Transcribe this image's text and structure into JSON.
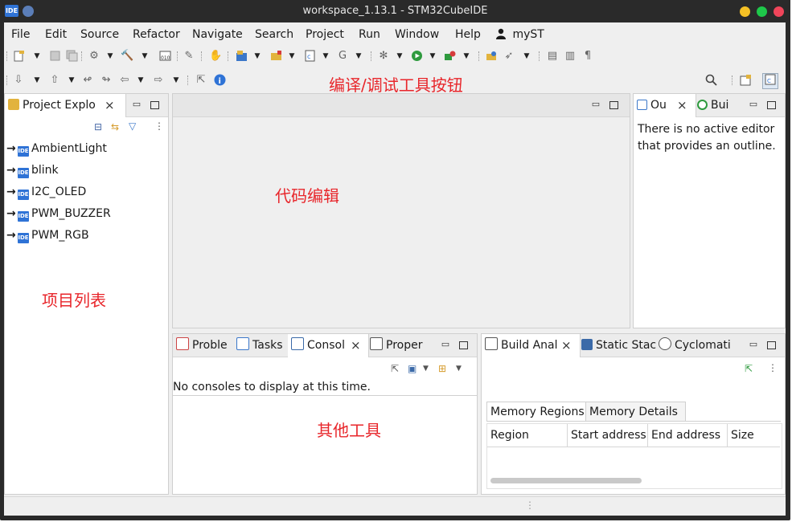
{
  "window": {
    "title": "workspace_1.13.1 - STM32CubeIDE",
    "app_icon_text": "IDE"
  },
  "colors": {
    "annotation": "#e8262b",
    "ide_blue": "#2f73d6",
    "frame": "#2a2a2a"
  },
  "menu": [
    {
      "label": "File"
    },
    {
      "label": "Edit"
    },
    {
      "label": "Source"
    },
    {
      "label": "Refactor"
    },
    {
      "label": "Navigate"
    },
    {
      "label": "Search"
    },
    {
      "label": "Project"
    },
    {
      "label": "Run"
    },
    {
      "label": "Window"
    },
    {
      "label": "Help"
    },
    {
      "label": "myST",
      "icon": "user-icon"
    }
  ],
  "annotations": {
    "toolbar": "编译/调试工具按钮",
    "editor": "代码编辑",
    "project_list": "项目列表",
    "other_tools": "其他工具"
  },
  "project_explorer": {
    "tab_label": "Project Explo",
    "projects": [
      {
        "name": "AmbientLight"
      },
      {
        "name": "blink"
      },
      {
        "name": "I2C_OLED"
      },
      {
        "name": "PWM_BUZZER"
      },
      {
        "name": "PWM_RGB"
      }
    ]
  },
  "outline": {
    "tabs": [
      "Ou",
      "Bui"
    ],
    "message": "There is no active editor that provides an outline."
  },
  "bottom_left": {
    "tabs": [
      "Proble",
      "Tasks",
      "Consol",
      "Proper"
    ],
    "message": "No consoles to display at this time."
  },
  "bottom_right": {
    "tabs": [
      "Build Anal",
      "Static Stac",
      "Cyclomati"
    ],
    "sub_tabs": [
      "Memory Regions",
      "Memory Details"
    ],
    "columns": [
      "Region",
      "Start address",
      "End address",
      "Size"
    ]
  },
  "icons": {
    "close": "×",
    "ide_badge": "IDE",
    "info": "i",
    "search": "search-icon",
    "menu_dots": "⋮"
  }
}
